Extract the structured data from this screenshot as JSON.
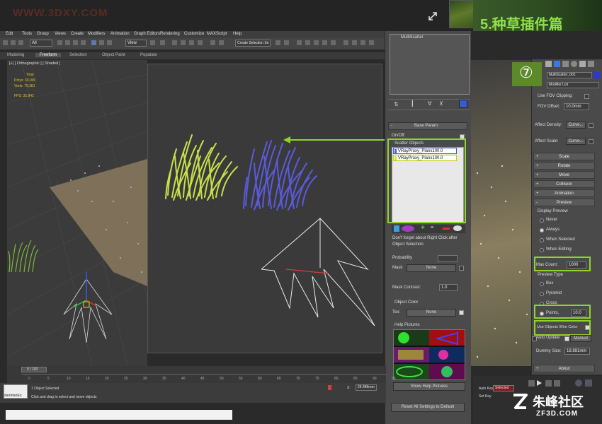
{
  "watermark": "WWW.3DXY.COM",
  "banner": "5.种草插件篇",
  "step_badge": "⑦",
  "menu": [
    "Edit",
    "Tools",
    "Group",
    "Views",
    "Create",
    "Modifiers",
    "Animation",
    "Graph Editors",
    "Rendering",
    "Customize",
    "MAXScript",
    "Help"
  ],
  "toolbar": {
    "filter": "All",
    "view_dropdown": "View",
    "selection_set": "Create Selection Se"
  },
  "ribbon_tabs": [
    "Modeling",
    "Freeform",
    "Selection",
    "Object Paint",
    "Populate"
  ],
  "viewport": {
    "label": "[+] [ Orthographic ] [ Shaded ]",
    "stats": {
      "total_label": "Total",
      "polys_label": "Polys:",
      "polys": "30,000",
      "verts_label": "Verts:",
      "verts": "79,381",
      "fps_label": "FPS:",
      "fps": "35.842"
    }
  },
  "multiscatter": {
    "title": "MultiScatter",
    "base_param": "Base Param",
    "onoff": "On/Off:",
    "scatter_objects_label": "Scatter Objects",
    "scatter_objects": [
      "VRayProxy_Planx100.0",
      "VRayProxy_Planx100.0"
    ],
    "hint": "Don't forget about Right Click after Object Selection.",
    "probability_label": "Probability",
    "mask_label": "Mask",
    "mask_value": "None",
    "mask_contrast_label": "Mask Contrast:",
    "mask_contrast": "1.0",
    "object_color_label": "Object Color",
    "tex_label": "Tex:",
    "tex_value": "None",
    "help_pictures_label": "Help Pictures",
    "show_help_pictures": "Show Help Pictures",
    "reset_button": "Reset All Settings to Default"
  },
  "command_panel": {
    "object_name": "MultiScatter_001",
    "modifier_list": "Modifier List",
    "use_fov_clipping": "Use FOV Clipping:",
    "fov_offset_label": "FOV Offset:",
    "fov_offset": "10.0mm",
    "affect_density": "Affect Density:",
    "affect_scale": "Affect Scale:",
    "curve": "Curve...",
    "rollouts": [
      "Scale",
      "Rotate",
      "Move",
      "Collision",
      "Animation",
      "Preview"
    ],
    "display_preview_label": "Display Preview",
    "display_preview": [
      "Never",
      "Always",
      "When Selected",
      "When Editing"
    ],
    "display_selected": "Always",
    "max_count_label": "Max Count:",
    "max_count": "1000",
    "preview_type_label": "Preview Type",
    "preview_type": [
      "Box",
      "Pyramid",
      "Cross",
      "Points,"
    ],
    "preview_selected": "Points,",
    "points_value": "10.0",
    "use_wire_color": "Use Objects Wire Color",
    "auto_update": "Auto Update",
    "manual": "Manual",
    "dummy_size_label": "Dummy Size:",
    "dummy_size": "18.891mm",
    "about": "About"
  },
  "timeline": {
    "frame": "0 / 100",
    "ticks": [
      "0",
      "5",
      "10",
      "15",
      "20",
      "25",
      "30",
      "35",
      "40",
      "45",
      "50",
      "55",
      "60",
      "65",
      "70",
      "75",
      "80",
      "85",
      "90",
      "95"
    ]
  },
  "status": {
    "selected": "1 Object Selected",
    "prompt": "Click and drag to select and move objects",
    "maxscript": "sterInterEx:",
    "x": "26.489mm",
    "auto_key": "Auto Key",
    "set_key": "Set Key",
    "key_mode": "Selected"
  },
  "footer_logo": {
    "cn": "朱峰社区",
    "en": "ZF3D.COM"
  },
  "colors": {
    "accent_green": "#8fd42a",
    "yellow_grass": "#c8e04a",
    "blue_grass": "#5a5ae0",
    "viewport_bg": "#3b3b3b"
  }
}
